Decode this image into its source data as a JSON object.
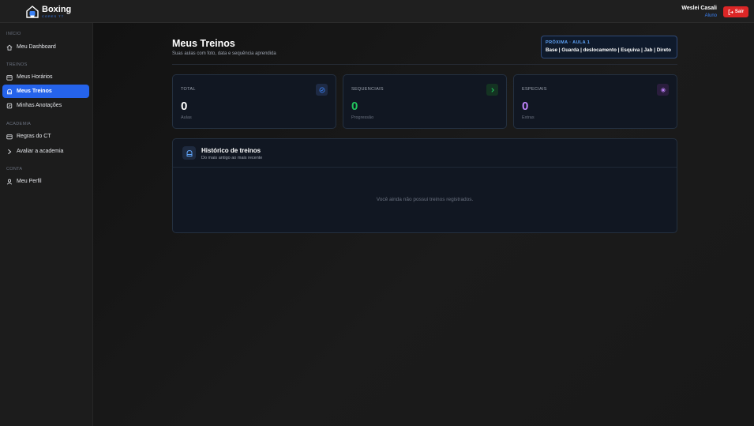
{
  "app": {
    "logo_title": "Boxing",
    "logo_sub": "CORES TT"
  },
  "user": {
    "name": "Weslei Casali",
    "role": "Aluno",
    "logout_label": "Sair"
  },
  "sidebar": {
    "sections": [
      {
        "label": "INÍCIO"
      },
      {
        "label": "TREINOS"
      },
      {
        "label": "ACADEMIA"
      },
      {
        "label": "CONTA"
      }
    ],
    "items": [
      {
        "label": "Meu Dashboard",
        "icon": "home-icon"
      },
      {
        "label": "Meus Horários",
        "icon": "calendar-icon"
      },
      {
        "label": "Meus Treinos",
        "icon": "boxing-glove-icon",
        "active": true
      },
      {
        "label": "Minhas Anotações",
        "icon": "notes-icon"
      },
      {
        "label": "Regras do CT",
        "icon": "rules-icon"
      },
      {
        "label": "Avaliar a academia",
        "icon": "rating-icon"
      },
      {
        "label": "Meu Perfil",
        "icon": "user-icon"
      }
    ]
  },
  "page": {
    "title": "Meus Treinos",
    "subtitle": "Suas aulas com foto, data e sequência aprendida"
  },
  "next_lesson": {
    "label": "PRÓXIMA · AULA 1",
    "topics": "Base | Guarda | deslocamento | Esquiva | Jab | Direto"
  },
  "stats": [
    {
      "title": "TOTAL",
      "value": "0",
      "note": "Aulas",
      "color": "#ffffff",
      "icon": "check-circle-icon",
      "icon_color": "#3b82f6",
      "icon_bg": "#1e2a44"
    },
    {
      "title": "SEQUENCIAIS",
      "value": "0",
      "note": "Progressão",
      "color": "#22c55e",
      "icon": "chevron-right-icon",
      "icon_color": "#22c55e",
      "icon_bg": "#143322"
    },
    {
      "title": "ESPECIAIS",
      "value": "0",
      "note": "Extras",
      "color": "#c084fc",
      "icon": "sparkle-icon",
      "icon_color": "#c084fc",
      "icon_bg": "#2a1d3d"
    }
  ],
  "history": {
    "title": "Histórico de treinos",
    "subtitle": "Do mais antigo ao mais recente",
    "empty_message": "Você ainda não possui treinos registrados."
  },
  "colors": {
    "accent": "#2563eb",
    "danger": "#dc2626"
  }
}
